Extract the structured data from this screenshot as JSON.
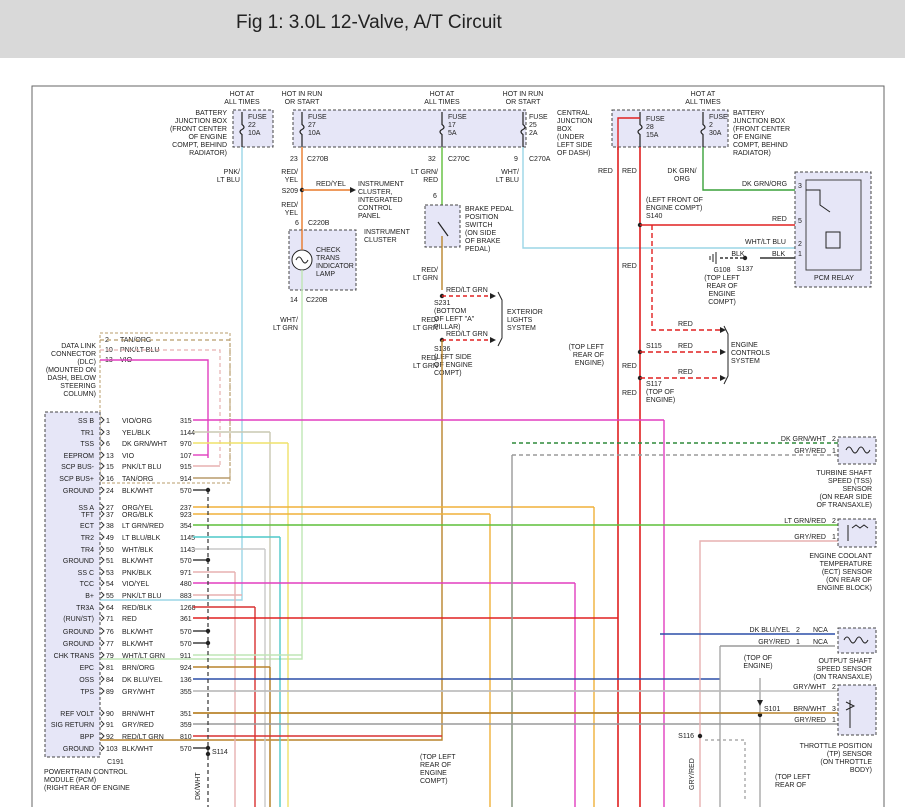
{
  "title": "Fig 1: 3.0L 12-Valve, A/T Circuit",
  "top": {
    "hot_all": [
      "HOT AT",
      "ALL TIMES"
    ],
    "hot_run": [
      "HOT IN RUN",
      "OR START"
    ],
    "battery_jb": [
      "BATTERY",
      "JUNCTION BOX",
      "(FRONT CENTER",
      "OF ENGINE",
      "COMPT, BEHIND",
      "RADIATOR)"
    ],
    "battery_jb_right": [
      "BATTERY",
      "JUNCTION BOX",
      "(FRONT CENTER",
      "OF ENGINE",
      "COMPT, BEHIND",
      "RADIATOR)"
    ],
    "central_jb": [
      "CENTRAL",
      "JUNCTION",
      "BOX",
      "(UNDER",
      "LEFT SIDE",
      "OF DASH)"
    ],
    "fuse22": [
      "FUSE",
      "22",
      "10A"
    ],
    "fuse27": [
      "FUSE",
      "27",
      "10A"
    ],
    "fuse17": [
      "FUSE",
      "17",
      "5A"
    ],
    "fuse25": [
      "FUSE",
      "25",
      "2A"
    ],
    "fuse28": [
      "FUSE",
      "28",
      "15A"
    ],
    "fuse2": [
      "FUSE",
      "2",
      "30A"
    ]
  },
  "labels": {
    "c270b": "C270B",
    "c270c": "C270C",
    "c270a": "C270A",
    "c220b": "C220B",
    "pin23": "23",
    "pin32": "32",
    "pin9": "9",
    "pin6": "6",
    "pin14": "14",
    "pnk_lt_blu": [
      "PNK/",
      "LT BLU"
    ],
    "red_yel": [
      "RED/",
      "YEL"
    ],
    "red_yel_h": "RED/YEL",
    "s209": "S209",
    "instrument_cluster_panel": [
      "INSTRUMENT",
      "CLUSTER,",
      "INTEGRATED",
      "CONTROL",
      "PANEL"
    ],
    "instrument_cluster": [
      "INSTRUMENT",
      "CLUSTER"
    ],
    "check_trans": [
      "CHECK",
      "TRANS",
      "INDICATOR",
      "LAMP"
    ],
    "wht_lt_grn": [
      "WHT/",
      "LT GRN"
    ],
    "lt_grn_red": [
      "LT GRN/",
      "RED"
    ],
    "wht_lt_blu": [
      "WHT/",
      "LT BLU"
    ],
    "brake_switch": [
      "BRAKE PEDAL",
      "POSITION",
      "SWITCH",
      "(ON SIDE",
      "OF BRAKE",
      "PEDAL)"
    ],
    "red_lt_grn": [
      "RED/",
      "LT GRN"
    ],
    "red_lt_grn_h": "RED/LT GRN",
    "s231": [
      "S231",
      "(BOTTOM",
      "OF LEFT \"A\"",
      "PILLAR)"
    ],
    "s136": [
      "S136",
      "(LEFT SIDE",
      "OF ENGINE",
      "COMPT)"
    ],
    "exterior_lights": [
      "EXTERIOR",
      "LIGHTS",
      "SYSTEM"
    ],
    "red": "RED",
    "dk_grn_org": [
      "DK GRN/",
      "ORG"
    ],
    "dk_grn_org_h": "DK GRN/ORG",
    "s140": [
      "(LEFT FRONT OF",
      "ENGINE COMPT)",
      "S140"
    ],
    "wht_lt_blu_h": "WHT/LT BLU",
    "blk": "BLK",
    "g108": [
      "G108",
      "(TOP LEFT",
      "REAR OF",
      "ENGINE",
      "COMPT)"
    ],
    "s137": "S137",
    "pcm_relay": "PCM RELAY",
    "s115_loc": [
      "(TOP LEFT",
      "REAR OF",
      "ENGINE)"
    ],
    "s115": "S115",
    "s117": [
      "S117",
      "(TOP OF",
      "ENGINE)"
    ],
    "engine_controls": [
      "ENGINE",
      "CONTROLS",
      "SYSTEM"
    ],
    "dlc": [
      "DATA LINK",
      "CONNECTOR",
      "(DLC)",
      "(MOUNTED ON",
      "DASH, BELOW",
      "STEERING",
      "COLUMN)"
    ],
    "dlc_pins": [
      [
        "2",
        "TAN/ORG"
      ],
      [
        "10",
        "PNK/LT BLU"
      ],
      [
        "13",
        "VIO"
      ]
    ],
    "tss_sensor": [
      "TURBINE SHAFT",
      "SPEED (TSS)",
      "SENSOR",
      "(ON REAR SIDE",
      "OF TRANSAXLE)"
    ],
    "tss_wires": [
      [
        "DK GRN/WHT",
        "2"
      ],
      [
        "GRY/RED",
        "1"
      ]
    ],
    "ect_sensor": [
      "ENGINE COOLANT",
      "TEMPERATURE",
      "(ECT) SENSOR",
      "(ON REAR OF",
      "ENGINE BLOCK)"
    ],
    "ect_wires": [
      [
        "LT GRN/RED",
        "2"
      ],
      [
        "GRY/RED",
        "1"
      ]
    ],
    "oss_sensor": [
      "OUTPUT SHAFT",
      "SPEED SENSOR",
      "(ON TRANSAXLE)"
    ],
    "oss_wires": [
      [
        "DK BLU/YEL",
        "2",
        "NCA"
      ],
      [
        "GRY/RED",
        "1",
        "NCA"
      ]
    ],
    "tp_sensor": [
      "THROTTLE POSITION",
      "(TP) SENSOR",
      "(ON THROTTLE",
      "BODY)"
    ],
    "tp_wires": [
      [
        "GRY/WHT",
        "2"
      ],
      [
        "BRN/WHT",
        "3"
      ],
      [
        "GRY/RED",
        "1"
      ]
    ],
    "s101_loc": [
      "(TOP OF",
      "ENGINE)"
    ],
    "s101": "S101",
    "s116": "S116",
    "s114": "S114",
    "c191": "C191",
    "pcm": [
      "POWERTRAIN CONTROL",
      "MODULE (PCM)",
      "(RIGHT REAR OF ENGINE"
    ],
    "bottom_loc": [
      "(TOP LEFT",
      "REAR OF",
      "ENGINE",
      "COMPT)"
    ],
    "bottom_loc2": [
      "(TOP LEFT",
      "REAR OF"
    ],
    "dkwht": "DK/WHT",
    "gryred_v": "GRY/RED"
  },
  "pcm_pins": [
    {
      "name": "SS B",
      "pin": "1",
      "wire": "VIO/ORG",
      "circuit": "315",
      "color": "#e23fbf"
    },
    {
      "name": "TR1",
      "pin": "3",
      "wire": "YEL/BLK",
      "circuit": "1144",
      "color": "#c9c8b2"
    },
    {
      "name": "TSS",
      "pin": "6",
      "wire": "DK GRN/WHT",
      "circuit": "970",
      "color": "#efe26a"
    },
    {
      "name": "EEPROM",
      "pin": "13",
      "wire": "VIO",
      "circuit": "107",
      "color": "#e23fbf"
    },
    {
      "name": "SCP BUS-",
      "pin": "15",
      "wire": "PNK/LT BLU",
      "circuit": "915",
      "color": "#e7b0b0"
    },
    {
      "name": "SCP BUS+",
      "pin": "16",
      "wire": "TAN/ORG",
      "circuit": "914",
      "color": "#b89c6b"
    },
    {
      "name": "GROUND",
      "pin": "24",
      "wire": "BLK/WHT",
      "circuit": "570",
      "color": "#333333"
    },
    {
      "name": "SS A",
      "pin": "27",
      "wire": "ORG/YEL",
      "circuit": "237",
      "color": "#f0b13a"
    },
    {
      "name": "TFT",
      "pin": "37",
      "wire": "ORG/BLK",
      "circuit": "923",
      "color": "#f0b13a"
    },
    {
      "name": "ECT",
      "pin": "38",
      "wire": "LT GRN/RED",
      "circuit": "354",
      "color": "#5fbf3a"
    },
    {
      "name": "TR2",
      "pin": "49",
      "wire": "LT BLU/BLK",
      "circuit": "1145",
      "color": "#4fc9c9"
    },
    {
      "name": "TR4",
      "pin": "50",
      "wire": "WHT/BLK",
      "circuit": "1143",
      "color": "#c9c9c9"
    },
    {
      "name": "GROUND",
      "pin": "51",
      "wire": "BLK/WHT",
      "circuit": "570",
      "color": "#333333"
    },
    {
      "name": "SS C",
      "pin": "53",
      "wire": "PNK/BLK",
      "circuit": "971",
      "color": "#e7b0b0"
    },
    {
      "name": "TCC",
      "pin": "54",
      "wire": "VIO/YEL",
      "circuit": "480",
      "color": "#e23fbf"
    },
    {
      "name": "B+",
      "pin": "55",
      "wire": "PNK/LT BLU",
      "circuit": "883",
      "color": "#e7b0b0"
    },
    {
      "name": "TR3A",
      "pin": "64",
      "wire": "RED/BLK",
      "circuit": "1268",
      "color": "#d93030"
    },
    {
      "name": "(RUN/ST)",
      "pin": "71",
      "wire": "RED",
      "circuit": "361",
      "color": "#e02020"
    },
    {
      "name": "GROUND",
      "pin": "76",
      "wire": "BLK/WHT",
      "circuit": "570",
      "color": "#333333"
    },
    {
      "name": "GROUND",
      "pin": "77",
      "wire": "BLK/WHT",
      "circuit": "570",
      "color": "#333333"
    },
    {
      "name": "CHK TRANS",
      "pin": "79",
      "wire": "WHT/LT GRN",
      "circuit": "911",
      "color": "#bfe6b5"
    },
    {
      "name": "EPC",
      "pin": "81",
      "wire": "BRN/ORG",
      "circuit": "924",
      "color": "#b9842c"
    },
    {
      "name": "OSS",
      "pin": "84",
      "wire": "DK BLU/YEL",
      "circuit": "136",
      "color": "#2c4fa8"
    },
    {
      "name": "TPS",
      "pin": "89",
      "wire": "GRY/WHT",
      "circuit": "355",
      "color": "#bdbdbd"
    },
    {
      "name": "REF VOLT",
      "pin": "90",
      "wire": "BRN/WHT",
      "circuit": "351",
      "color": "#b9842c"
    },
    {
      "name": "SIG RETURN",
      "pin": "91",
      "wire": "GRY/RED",
      "circuit": "359",
      "color": "#9a9a9a"
    },
    {
      "name": "BPP",
      "pin": "92",
      "wire": "RED/LT GRN",
      "circuit": "810",
      "color": "#d93030"
    },
    {
      "name": "GROUND",
      "pin": "103",
      "wire": "BLK/WHT",
      "circuit": "570",
      "color": "#333333"
    }
  ]
}
